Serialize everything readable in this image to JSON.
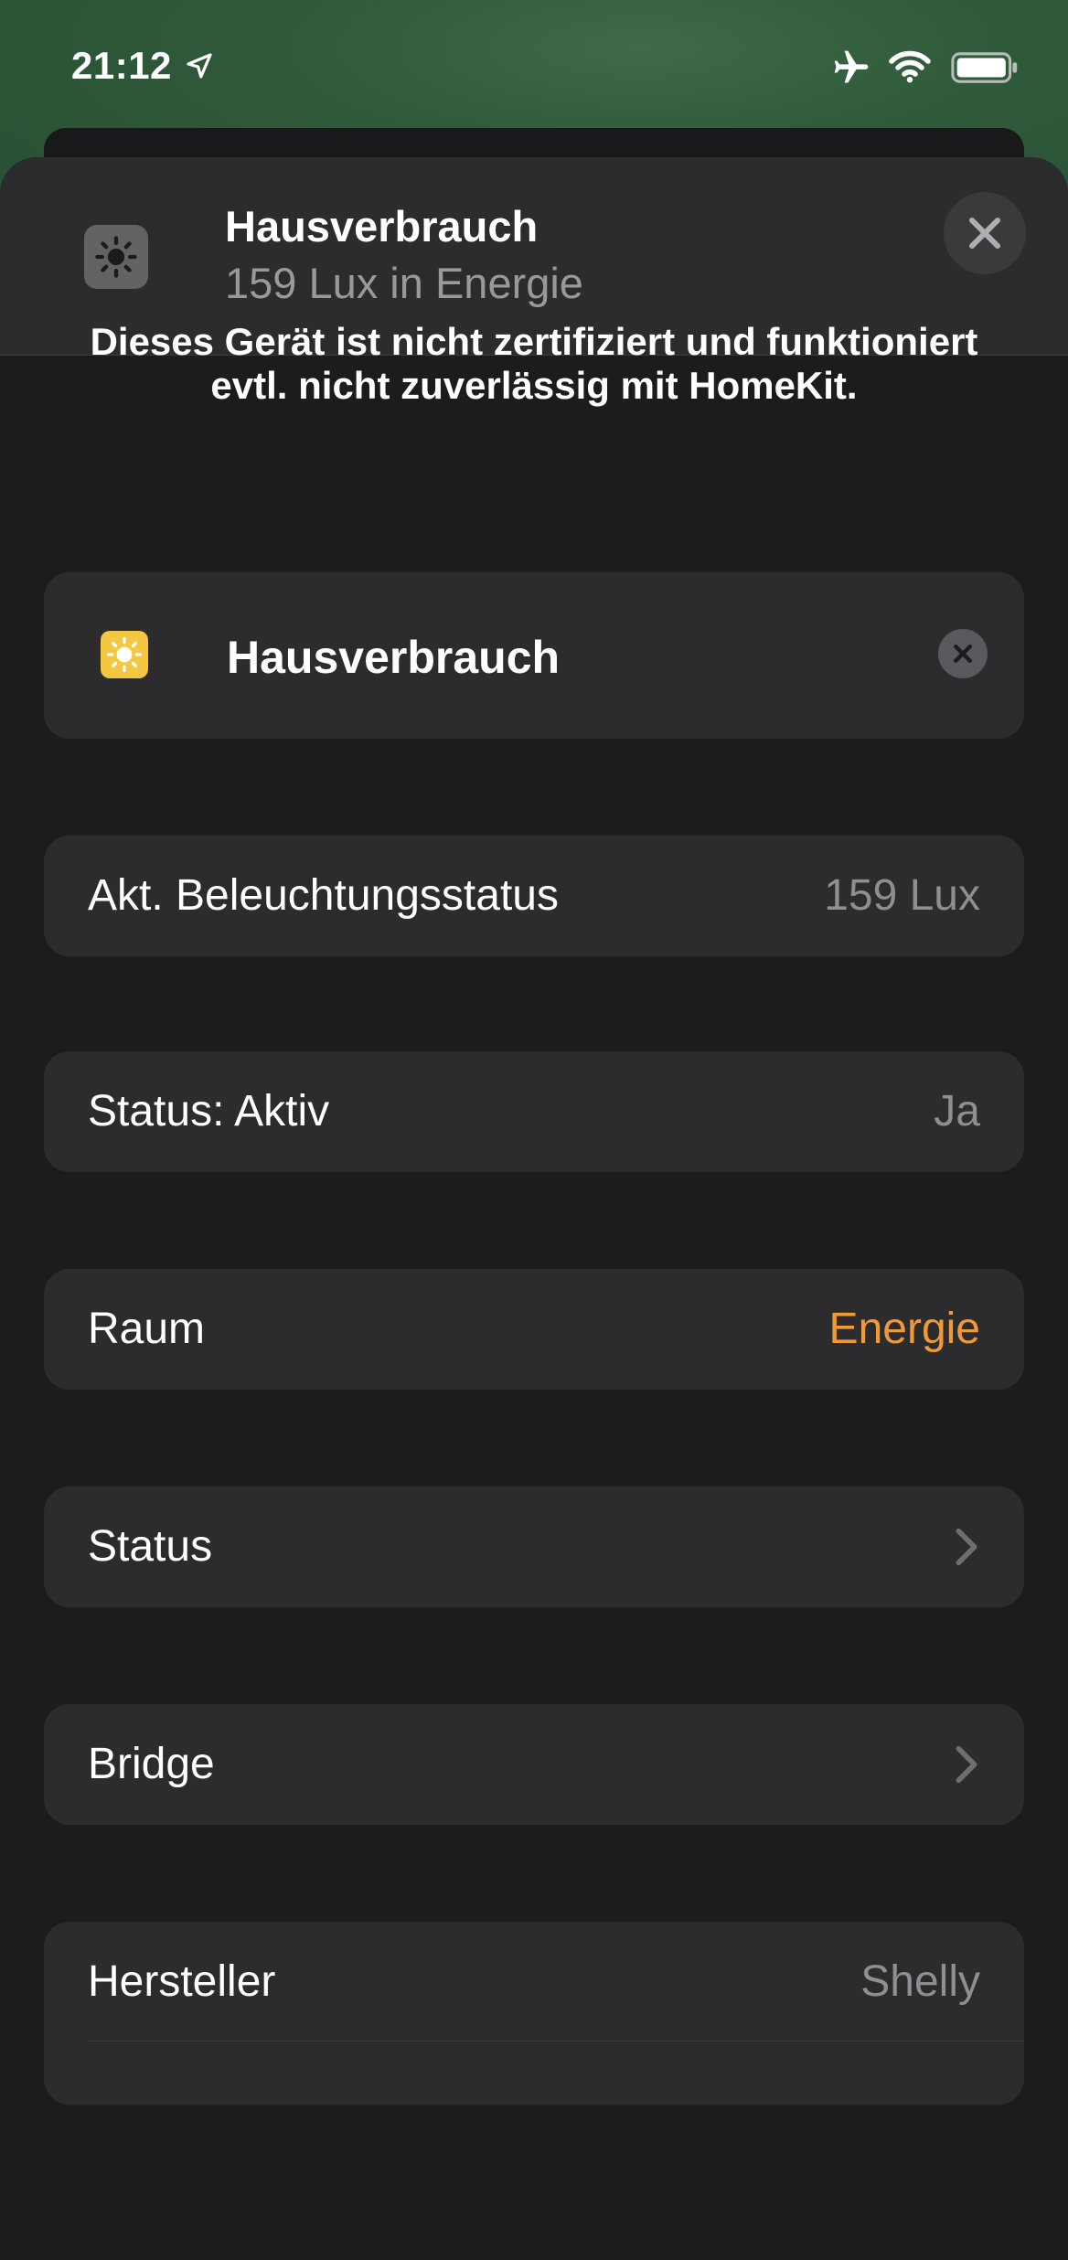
{
  "status_bar": {
    "time": "21:12"
  },
  "header": {
    "title": "Hausverbrauch",
    "subtitle": "159 Lux in Energie"
  },
  "notice": "Dieses Gerät ist nicht zertifiziert und funktioniert evtl. nicht zuverlässig mit HomeKit.",
  "device": {
    "name": "Hausverbrauch"
  },
  "rows": {
    "light_level": {
      "label": "Akt. Beleuchtungsstatus",
      "value": "159 Lux"
    },
    "status_active": {
      "label": "Status: Aktiv",
      "value": "Ja"
    },
    "room": {
      "label": "Raum",
      "value": "Energie"
    },
    "status": {
      "label": "Status"
    },
    "bridge": {
      "label": "Bridge"
    },
    "manufacturer": {
      "label": "Hersteller",
      "value": "Shelly"
    }
  },
  "colors": {
    "accent": "#f09a37",
    "sheet_background": "#1c1c1e",
    "card_background": "#2c2c2e",
    "device_icon": "#f4c741"
  },
  "icons": {
    "status_bar": [
      "location-arrow-icon",
      "airplane-icon",
      "wifi-icon",
      "battery-icon"
    ],
    "header": "light-sensor-icon",
    "close": "close-icon",
    "device": "sun-icon",
    "clear": "clear-icon",
    "row_disclosure": "chevron-right-icon"
  }
}
